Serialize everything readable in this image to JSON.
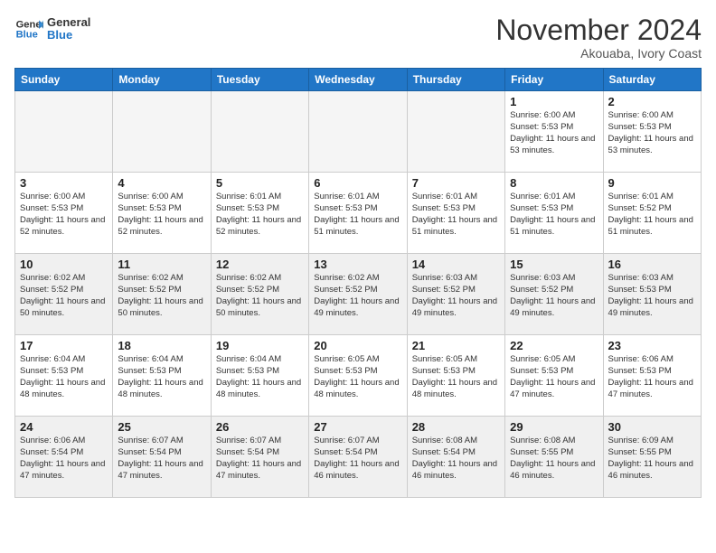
{
  "header": {
    "logo_line1": "General",
    "logo_line2": "Blue",
    "month_title": "November 2024",
    "location": "Akouaba, Ivory Coast"
  },
  "weekdays": [
    "Sunday",
    "Monday",
    "Tuesday",
    "Wednesday",
    "Thursday",
    "Friday",
    "Saturday"
  ],
  "weeks": [
    [
      {
        "day": "",
        "empty": true
      },
      {
        "day": "",
        "empty": true
      },
      {
        "day": "",
        "empty": true
      },
      {
        "day": "",
        "empty": true
      },
      {
        "day": "",
        "empty": true
      },
      {
        "day": "1",
        "sunrise": "6:00 AM",
        "sunset": "5:53 PM",
        "daylight": "11 hours and 53 minutes."
      },
      {
        "day": "2",
        "sunrise": "6:00 AM",
        "sunset": "5:53 PM",
        "daylight": "11 hours and 53 minutes."
      }
    ],
    [
      {
        "day": "3",
        "sunrise": "6:00 AM",
        "sunset": "5:53 PM",
        "daylight": "11 hours and 52 minutes."
      },
      {
        "day": "4",
        "sunrise": "6:00 AM",
        "sunset": "5:53 PM",
        "daylight": "11 hours and 52 minutes."
      },
      {
        "day": "5",
        "sunrise": "6:01 AM",
        "sunset": "5:53 PM",
        "daylight": "11 hours and 52 minutes."
      },
      {
        "day": "6",
        "sunrise": "6:01 AM",
        "sunset": "5:53 PM",
        "daylight": "11 hours and 51 minutes."
      },
      {
        "day": "7",
        "sunrise": "6:01 AM",
        "sunset": "5:53 PM",
        "daylight": "11 hours and 51 minutes."
      },
      {
        "day": "8",
        "sunrise": "6:01 AM",
        "sunset": "5:53 PM",
        "daylight": "11 hours and 51 minutes."
      },
      {
        "day": "9",
        "sunrise": "6:01 AM",
        "sunset": "5:52 PM",
        "daylight": "11 hours and 51 minutes."
      }
    ],
    [
      {
        "day": "10",
        "sunrise": "6:02 AM",
        "sunset": "5:52 PM",
        "daylight": "11 hours and 50 minutes."
      },
      {
        "day": "11",
        "sunrise": "6:02 AM",
        "sunset": "5:52 PM",
        "daylight": "11 hours and 50 minutes."
      },
      {
        "day": "12",
        "sunrise": "6:02 AM",
        "sunset": "5:52 PM",
        "daylight": "11 hours and 50 minutes."
      },
      {
        "day": "13",
        "sunrise": "6:02 AM",
        "sunset": "5:52 PM",
        "daylight": "11 hours and 49 minutes."
      },
      {
        "day": "14",
        "sunrise": "6:03 AM",
        "sunset": "5:52 PM",
        "daylight": "11 hours and 49 minutes."
      },
      {
        "day": "15",
        "sunrise": "6:03 AM",
        "sunset": "5:52 PM",
        "daylight": "11 hours and 49 minutes."
      },
      {
        "day": "16",
        "sunrise": "6:03 AM",
        "sunset": "5:53 PM",
        "daylight": "11 hours and 49 minutes."
      }
    ],
    [
      {
        "day": "17",
        "sunrise": "6:04 AM",
        "sunset": "5:53 PM",
        "daylight": "11 hours and 48 minutes."
      },
      {
        "day": "18",
        "sunrise": "6:04 AM",
        "sunset": "5:53 PM",
        "daylight": "11 hours and 48 minutes."
      },
      {
        "day": "19",
        "sunrise": "6:04 AM",
        "sunset": "5:53 PM",
        "daylight": "11 hours and 48 minutes."
      },
      {
        "day": "20",
        "sunrise": "6:05 AM",
        "sunset": "5:53 PM",
        "daylight": "11 hours and 48 minutes."
      },
      {
        "day": "21",
        "sunrise": "6:05 AM",
        "sunset": "5:53 PM",
        "daylight": "11 hours and 48 minutes."
      },
      {
        "day": "22",
        "sunrise": "6:05 AM",
        "sunset": "5:53 PM",
        "daylight": "11 hours and 47 minutes."
      },
      {
        "day": "23",
        "sunrise": "6:06 AM",
        "sunset": "5:53 PM",
        "daylight": "11 hours and 47 minutes."
      }
    ],
    [
      {
        "day": "24",
        "sunrise": "6:06 AM",
        "sunset": "5:54 PM",
        "daylight": "11 hours and 47 minutes."
      },
      {
        "day": "25",
        "sunrise": "6:07 AM",
        "sunset": "5:54 PM",
        "daylight": "11 hours and 47 minutes."
      },
      {
        "day": "26",
        "sunrise": "6:07 AM",
        "sunset": "5:54 PM",
        "daylight": "11 hours and 47 minutes."
      },
      {
        "day": "27",
        "sunrise": "6:07 AM",
        "sunset": "5:54 PM",
        "daylight": "11 hours and 46 minutes."
      },
      {
        "day": "28",
        "sunrise": "6:08 AM",
        "sunset": "5:54 PM",
        "daylight": "11 hours and 46 minutes."
      },
      {
        "day": "29",
        "sunrise": "6:08 AM",
        "sunset": "5:55 PM",
        "daylight": "11 hours and 46 minutes."
      },
      {
        "day": "30",
        "sunrise": "6:09 AM",
        "sunset": "5:55 PM",
        "daylight": "11 hours and 46 minutes."
      }
    ]
  ]
}
